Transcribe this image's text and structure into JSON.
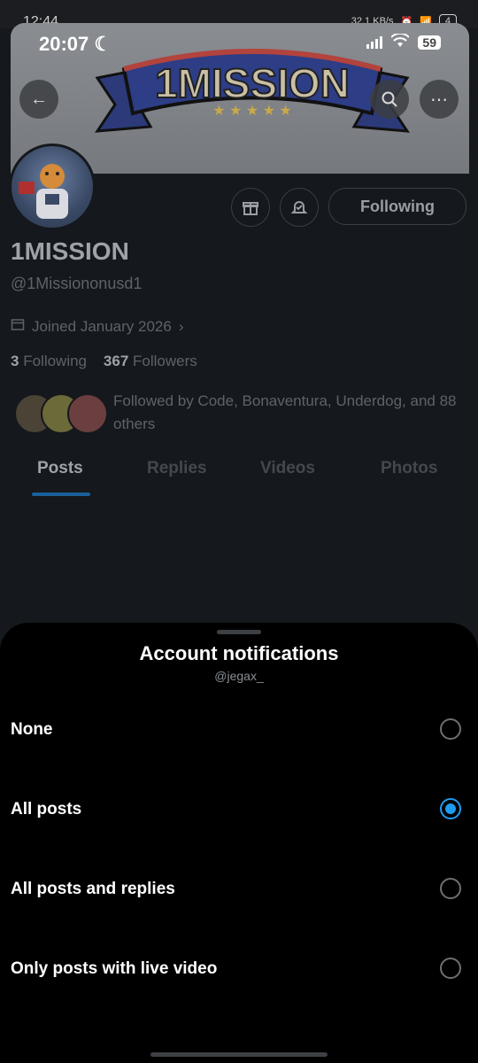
{
  "outer_status": {
    "time": "12:44",
    "net_speed": "32.1 KB/s",
    "battery": "4"
  },
  "inner_status": {
    "time": "20:07",
    "battery": "59"
  },
  "banner": {
    "logo_text": "1MISSION"
  },
  "profile": {
    "display_name": "1MISSION",
    "handle": "@1Missiononusd1",
    "joined": "Joined January 2026",
    "following_count": "3",
    "following_label": "Following",
    "followers_count": "367",
    "followers_label": "Followers",
    "followed_by": "Followed by Code, Bonaventura, Underdog, and 88 others",
    "follow_button": "Following"
  },
  "tabs": [
    "Posts",
    "Replies",
    "Videos",
    "Photos"
  ],
  "sheet": {
    "title": "Account notifications",
    "subtitle": "@jegax_",
    "options": [
      {
        "label": "None",
        "selected": false
      },
      {
        "label": "All posts",
        "selected": true
      },
      {
        "label": "All posts and replies",
        "selected": false
      },
      {
        "label": "Only posts with live video",
        "selected": false
      }
    ]
  },
  "colors": {
    "accent": "#1d9bf0",
    "sheet_bg": "#000000",
    "page_bg": "#15181c"
  }
}
